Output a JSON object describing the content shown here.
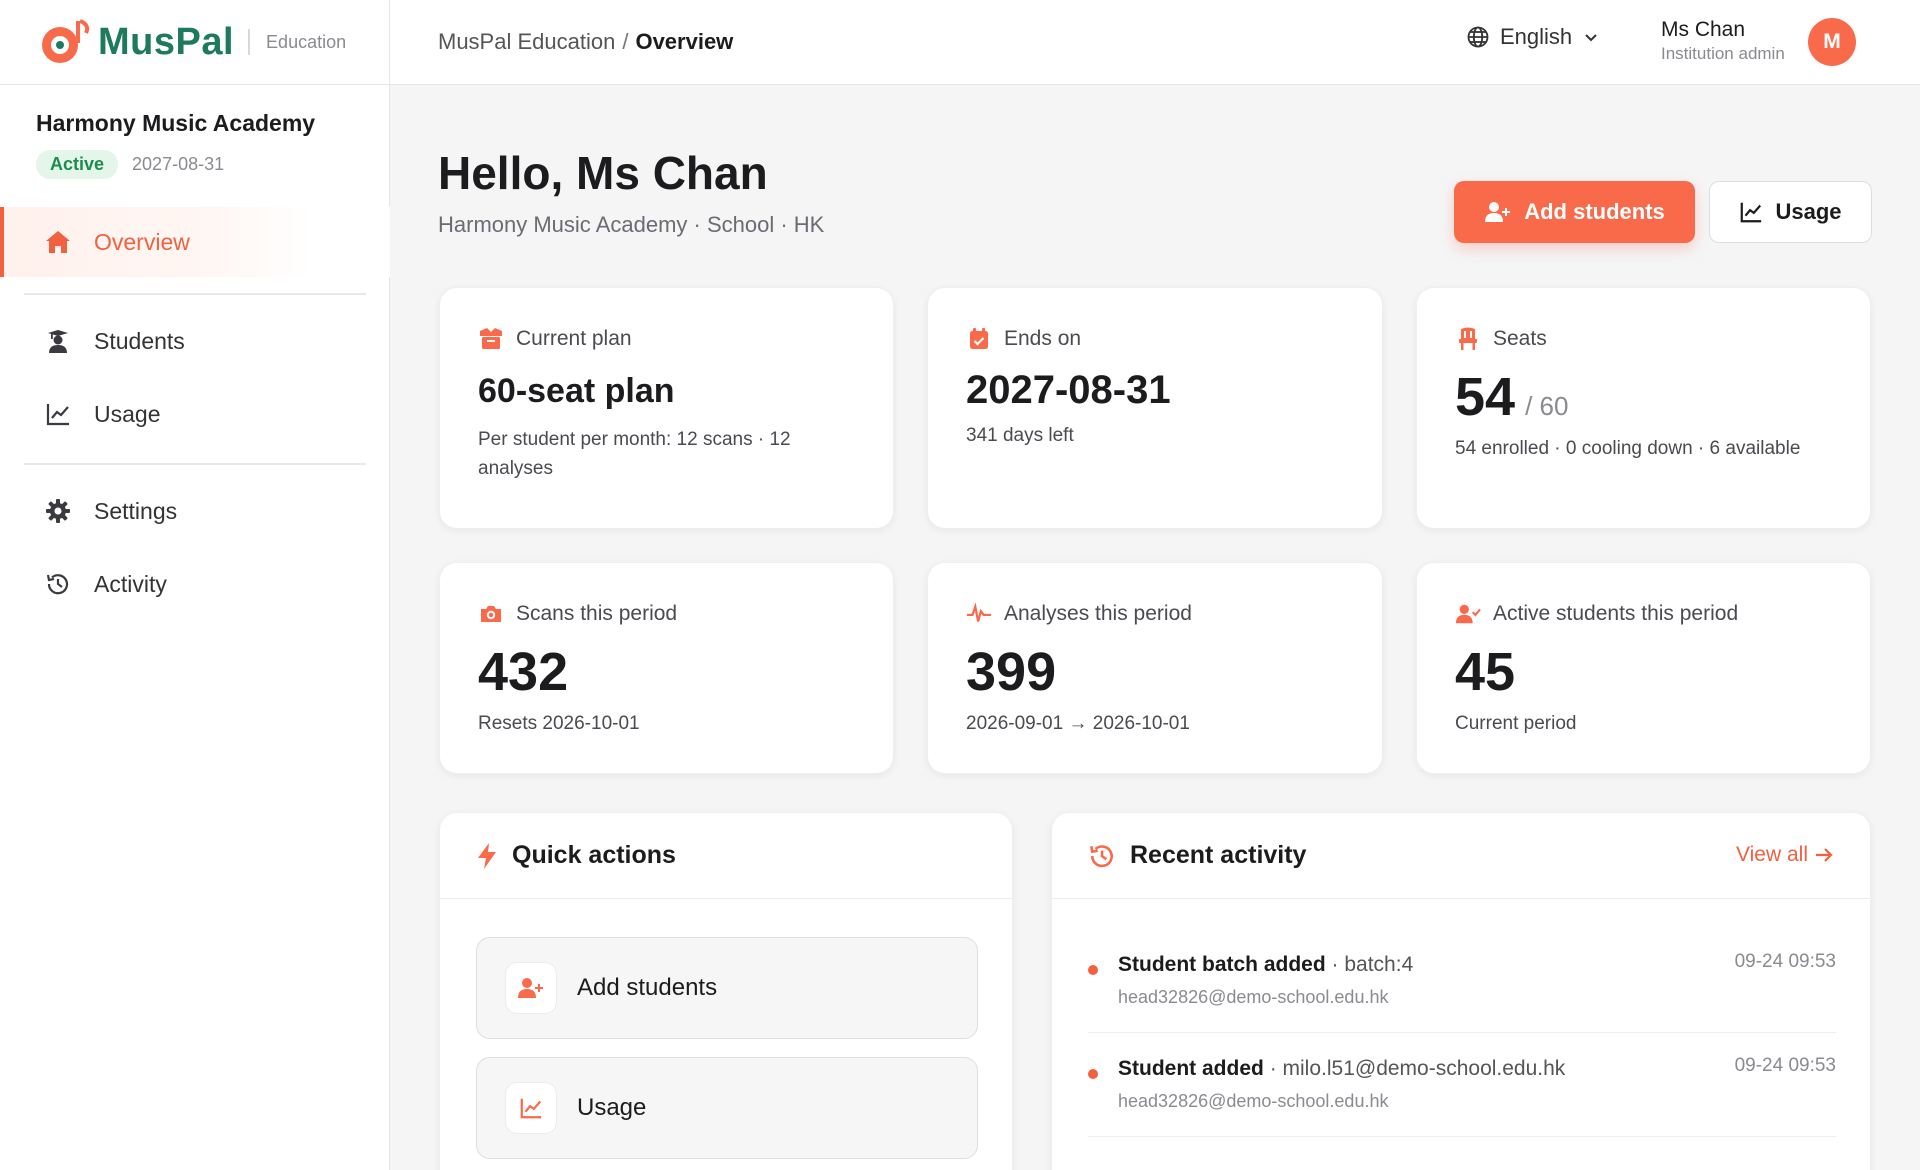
{
  "colors": {
    "accent": "#f96a4a",
    "brand": "#1d7a5f",
    "success": "#1e8c4e"
  },
  "header": {
    "brand_name": "MusPal",
    "brand_sub": "Education",
    "breadcrumb_root": "MusPal Education",
    "breadcrumb_sep": "/",
    "breadcrumb_current": "Overview",
    "language": "English",
    "user_name": "Ms Chan",
    "user_role": "Institution admin",
    "avatar_initial": "M"
  },
  "sidebar": {
    "org_name": "Harmony Music Academy",
    "status": "Active",
    "expiry": "2027-08-31",
    "items": [
      {
        "label": "Overview",
        "icon": "home-icon",
        "active": true
      },
      {
        "label": "Students",
        "icon": "graduate-icon"
      },
      {
        "label": "Usage",
        "icon": "chart-line-icon"
      },
      {
        "label": "Settings",
        "icon": "gear-icon"
      },
      {
        "label": "Activity",
        "icon": "history-icon"
      }
    ]
  },
  "main": {
    "greeting": "Hello, Ms Chan",
    "subtitle": "Harmony Music Academy · School · HK",
    "add_students_label": "Add students",
    "usage_label": "Usage"
  },
  "cards": {
    "plan": {
      "label": "Current plan",
      "value": "60-seat plan",
      "sub": "Per student per month: 12 scans · 12 analyses"
    },
    "ends": {
      "label": "Ends on",
      "value": "2027-08-31",
      "sub": "341 days left"
    },
    "seats": {
      "label": "Seats",
      "value": "54",
      "total": "/ 60",
      "sub": "54 enrolled · 0 cooling down · 6 available"
    },
    "scans": {
      "label": "Scans this period",
      "value": "432",
      "sub": "Resets 2026-10-01"
    },
    "analyses": {
      "label": "Analyses this period",
      "value": "399",
      "sub": "2026-09-01 → 2026-10-01"
    },
    "active": {
      "label": "Active students this period",
      "value": "45",
      "sub": "Current period"
    }
  },
  "quick_actions": {
    "title": "Quick actions",
    "items": [
      {
        "label": "Add students",
        "icon": "user-plus-icon"
      },
      {
        "label": "Usage",
        "icon": "chart-line-icon"
      }
    ]
  },
  "recent_activity": {
    "title": "Recent activity",
    "view_all": "View all",
    "items": [
      {
        "action": "Student batch added",
        "detail": "· batch:4",
        "actor": "head32826@demo-school.edu.hk",
        "time": "09-24 09:53"
      },
      {
        "action": "Student added",
        "detail": "· milo.l51@demo-school.edu.hk",
        "actor": "head32826@demo-school.edu.hk",
        "time": "09-24 09:53"
      }
    ]
  }
}
